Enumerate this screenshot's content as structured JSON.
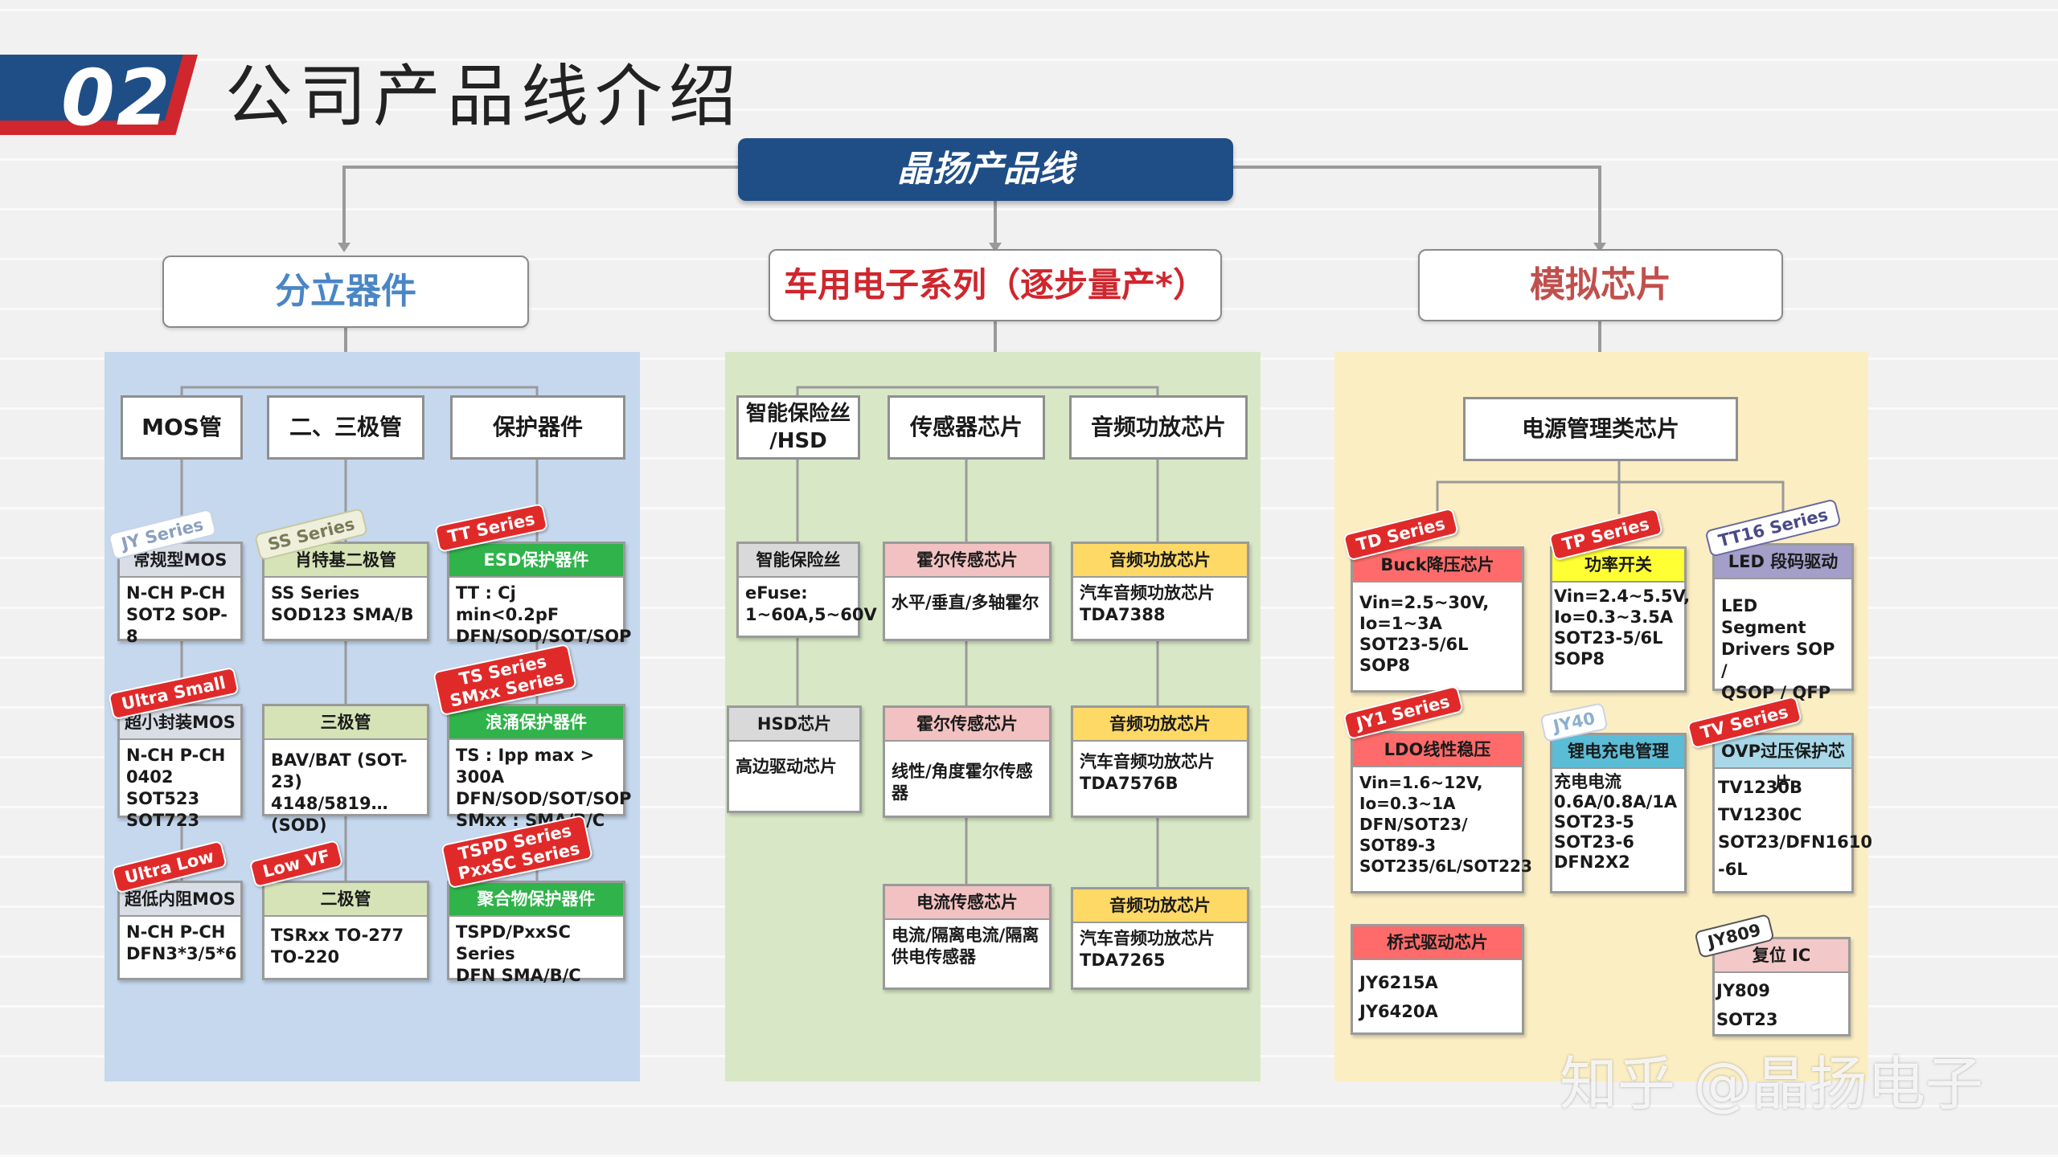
{
  "header": {
    "number": "02",
    "title": "公司产品线介绍"
  },
  "root": {
    "label": "晶扬产品线"
  },
  "categories": {
    "discrete": {
      "label": "分立器件",
      "color": "#4a86c5"
    },
    "auto": {
      "label": "车用电子系列（逐步量产*）",
      "color": "#d0262d"
    },
    "analog": {
      "label": "模拟芯片",
      "color": "#c0504d"
    }
  },
  "discrete": {
    "subs": [
      "MOS管",
      "二、三极管",
      "保护器件"
    ],
    "cards": [
      {
        "tag": "JY Series",
        "title": "常规型MOS",
        "body": "N-CH  P-CH\nSOT2 SOP-8",
        "hd_color": "#d9dde6"
      },
      {
        "tag": "SS Series",
        "title": "肖特基二极管",
        "body": "SS Series\nSOD123  SMA/B",
        "hd_color": "#d5e3b6"
      },
      {
        "tag": "TT Series",
        "title": "ESD保护器件",
        "body": "TT : Cj min<0.2pF\nDFN/SOD/SOT/SOP",
        "hd_color": "#2fb34a"
      },
      {
        "tag": "Ultra Small",
        "title": "超小封装MOS",
        "body": "N-CH  P-CH\n0402 SOT523\nSOT723",
        "hd_color": "#d9dde6"
      },
      {
        "tag": "",
        "title": "三极管",
        "body": "BAV/BAT (SOT-23)\n4148/5819…(SOD)",
        "hd_color": "#d5e3b6"
      },
      {
        "tag": "TS Series\nSMxx Series",
        "title": "浪涌保护器件",
        "body": "TS : Ipp max > 300A\nDFN/SOD/SOT/SOP\nSMxx : SMA/B/C",
        "hd_color": "#2fb34a"
      },
      {
        "tag": "Ultra Low",
        "title": "超低内阻MOS",
        "body": "N-CH  P-CH\nDFN3*3/5*6",
        "hd_color": "#d9dde6"
      },
      {
        "tag": "Low VF",
        "title": "二极管",
        "body": "TSRxx  TO-277\nTO-220",
        "hd_color": "#d5e3b6"
      },
      {
        "tag": "TSPD Series\nPxxSC Series",
        "title": "聚合物保护器件",
        "body": "TSPD/PxxSC Series\nDFN SMA/B/C",
        "hd_color": "#2fb34a"
      }
    ]
  },
  "auto": {
    "subs": [
      "智能保险丝\n/HSD",
      "传感器芯片",
      "音频功放芯片"
    ],
    "cards": [
      {
        "title": "智能保险丝",
        "body": "eFuse:\n1~60A,5~60V",
        "hd_color": "#d9d9d9"
      },
      {
        "title": "霍尔传感芯片",
        "body": "水平/垂直/多轴霍尔",
        "hd_color": "#f2c2c2"
      },
      {
        "title": "音频功放芯片",
        "body": "汽车音频功放芯片\nTDA7388",
        "hd_color": "#ffd966"
      },
      {
        "title": "HSD芯片",
        "body": "高边驱动芯片",
        "hd_color": "#d9d9d9"
      },
      {
        "title": "霍尔传感芯片",
        "body": "线性/角度霍尔传感器",
        "hd_color": "#f2c2c2"
      },
      {
        "title": "音频功放芯片",
        "body": "汽车音频功放芯片\nTDA7576B",
        "hd_color": "#ffd966"
      },
      {
        "title": "电流传感芯片",
        "body": "电流/隔离电流/隔离\n供电传感器",
        "hd_color": "#f2c2c2"
      },
      {
        "title": "音频功放芯片",
        "body": "汽车音频功放芯片\nTDA7265",
        "hd_color": "#ffd966"
      }
    ]
  },
  "analog": {
    "subs": [
      "电源管理类芯片"
    ],
    "cards": [
      {
        "tag": "TD Series",
        "title": "Buck降压芯片",
        "body": "Vin=2.5~30V,\nIo=1~3A\nSOT23-5/6L  SOP8",
        "hd_color": "#ff6b6b"
      },
      {
        "tag": "TP Series",
        "title": "功率开关",
        "body": "Vin=2.4~5.5V,\nIo=0.3~3.5A\nSOT23-5/6L\nSOP8",
        "hd_color": "#ffff33"
      },
      {
        "tag": "TT16 Series",
        "title": "LED 段码驱动",
        "body": "LED Segment\nDrivers  SOP /\nQSOP / QFP",
        "hd_color": "#a39fc9"
      },
      {
        "tag": "JY1 Series",
        "title": "LDO线性稳压",
        "body": "Vin=1.6~12V,\nIo=0.3~1A\nDFN/SOT23/\nSOT89-3\nSOT235/6L/SOT223",
        "hd_color": "#ff6b6b"
      },
      {
        "tag": "JY40",
        "title": "锂电充电管理",
        "body": "充电电流\n0.6A/0.8A/1A\nSOT23-5\nSOT23-6\nDFN2X2",
        "hd_color": "#5bbcd6"
      },
      {
        "tag": "TV Series",
        "title": "OVP过压保护芯片",
        "body": "TV1230B\nTV1230C\nSOT23/DFN1610\n-6L",
        "hd_color": "#a8d8e8"
      },
      {
        "tag": "",
        "title": "桥式驱动芯片",
        "body": "JY6215A\nJY6420A",
        "hd_color": "#ff6b6b"
      },
      {
        "tag": "JY809",
        "title": "复位 IC",
        "body": "JY809\nSOT23",
        "hd_color": "#f2c8c8"
      }
    ]
  },
  "watermark": "知乎 @晶扬电子"
}
